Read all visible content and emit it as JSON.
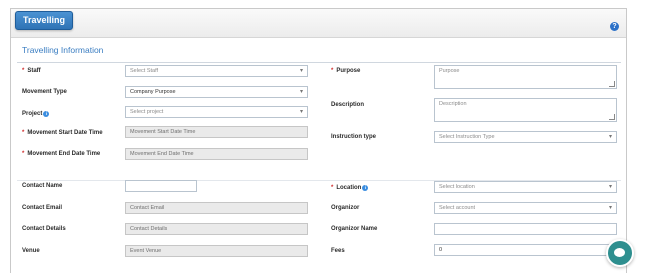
{
  "header": {
    "tab_label": "Travelling",
    "help_glyph": "?"
  },
  "section_title": "Travelling Information",
  "left_top": {
    "staff": {
      "label": "Staff",
      "placeholder": "Select Staff"
    },
    "movement_type": {
      "label": "Movement Type",
      "value": "Company Purpose"
    },
    "project": {
      "label": "Project",
      "placeholder": "Select project"
    },
    "start_date": {
      "label": "Movement Start Date Time",
      "placeholder": "Movement Start Date Time"
    },
    "end_date": {
      "label": "Movement End Date Time",
      "placeholder": "Movement End Date Time"
    }
  },
  "right_top": {
    "purpose": {
      "label": "Purpose",
      "placeholder": "Purpose"
    },
    "description": {
      "label": "Description",
      "placeholder": "Description"
    },
    "instruction_type": {
      "label": "Instruction type",
      "placeholder": "Select Instruction Type"
    }
  },
  "left_bottom": {
    "contact_name": {
      "label": "Contact Name",
      "value": ""
    },
    "contact_email": {
      "label": "Contact Email",
      "placeholder": "Contact Email"
    },
    "contact_details": {
      "label": "Contact Details",
      "placeholder": "Contact Details"
    },
    "venue": {
      "label": "Venue",
      "placeholder": "Event Venue"
    }
  },
  "right_bottom": {
    "location": {
      "label": "Location",
      "placeholder": "Select location"
    },
    "organizer": {
      "label": "Organizor",
      "placeholder": "Select account"
    },
    "organizer_name": {
      "label": "Organizor Name",
      "value": ""
    },
    "fees": {
      "label": "Fees",
      "value": "0"
    }
  },
  "icons": {
    "help": "help-icon",
    "info": "info-icon",
    "chat": "chat-icon",
    "dropdown": "chevron-down-icon"
  },
  "colors": {
    "accent": "#3b7ec2",
    "tab": "#2f73b5",
    "required": "#d02b2b",
    "chat": "#2e8f8f"
  }
}
